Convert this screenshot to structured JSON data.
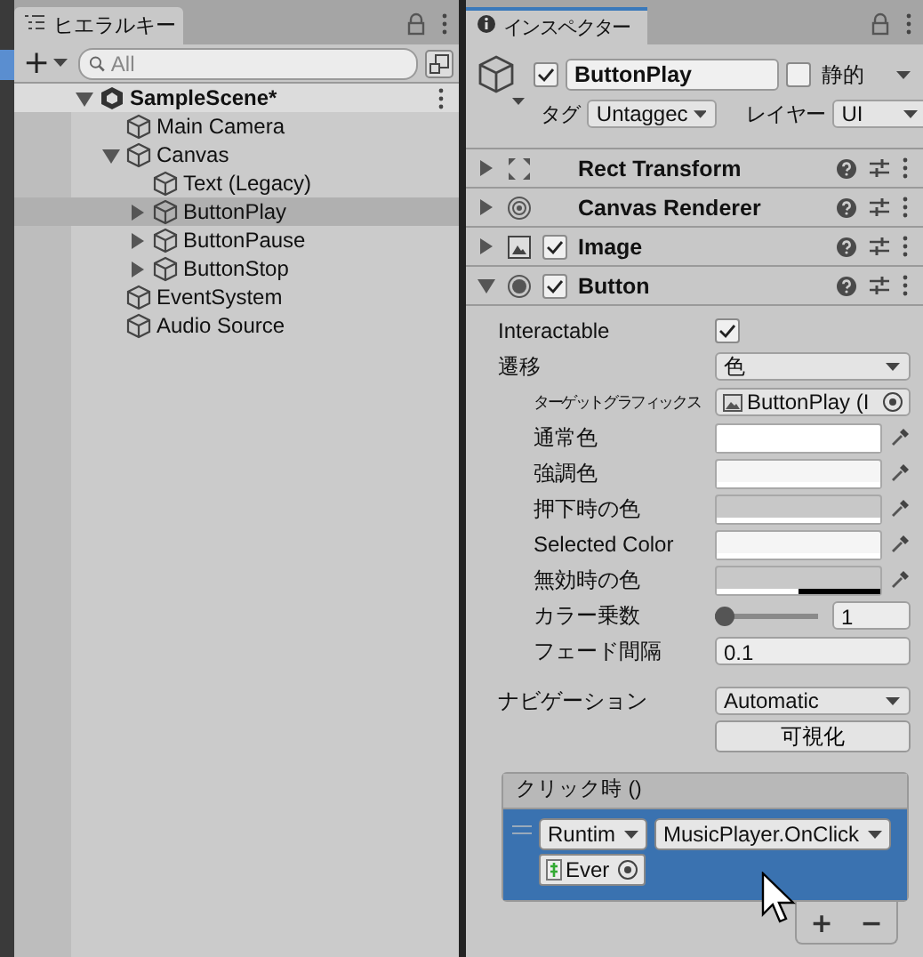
{
  "hierarchy": {
    "tab": "ヒエラルキー",
    "add_button": "+",
    "search": {
      "placeholder": "All"
    },
    "scene": {
      "name": "SampleScene*",
      "expanded": true
    },
    "items": [
      {
        "name": "Main Camera",
        "selected": false
      },
      {
        "name": "Canvas",
        "selected": false,
        "expanded": true,
        "children": [
          {
            "name": "Text (Legacy)",
            "selected": false
          },
          {
            "name": "ButtonPlay",
            "selected": true,
            "expanded": false
          },
          {
            "name": "ButtonPause",
            "selected": false,
            "expanded": false
          },
          {
            "name": "ButtonStop",
            "selected": false,
            "expanded": false
          }
        ]
      },
      {
        "name": "EventSystem",
        "selected": false
      },
      {
        "name": "Audio Source",
        "selected": false
      }
    ]
  },
  "inspector": {
    "tab": "インスペクター",
    "object": {
      "active": true,
      "name": "ButtonPlay",
      "static": false,
      "static_label": "静的",
      "tag_label": "タグ",
      "tag": "Untaggec",
      "layer_label": "レイヤー",
      "layer": "UI"
    },
    "components": [
      {
        "kind": "rect",
        "name": "Rect Transform",
        "expanded": false
      },
      {
        "kind": "renderer",
        "name": "Canvas Renderer",
        "expanded": false
      },
      {
        "kind": "image",
        "name": "Image",
        "expanded": false,
        "enabled": true
      },
      {
        "kind": "button",
        "name": "Button",
        "expanded": true,
        "enabled": true
      }
    ],
    "fields": [
      {
        "kind": "checkbox",
        "label": "Interactable",
        "checked": true
      },
      {
        "kind": "dropdown",
        "label": "遷移",
        "value": "色",
        "children": [
          {
            "kind": "object",
            "label": "ターゲットグラフィックス",
            "value": "ButtonPlay (I"
          },
          {
            "kind": "color",
            "label": "通常色",
            "color": "#ffffff",
            "level": 1
          },
          {
            "kind": "color",
            "label": "強調色",
            "color": "#f5f5f5",
            "level": 1
          },
          {
            "kind": "color",
            "label": "押下時の色",
            "color": "#c8c8c8",
            "level": 1
          },
          {
            "kind": "color",
            "label": "Selected Color",
            "color": "#f5f5f5",
            "level": 1
          },
          {
            "kind": "color",
            "label": "無効時の色",
            "color": "#c8c8c8",
            "level": 0.5
          },
          {
            "kind": "slider",
            "label": "カラー乗数",
            "level": 0,
            "value": "1"
          },
          {
            "kind": "number",
            "label": "フェード間隔",
            "value": "0.1"
          }
        ]
      },
      {
        "kind": "dropdown",
        "label": "ナビゲーション",
        "value": "Automatic"
      },
      {
        "kind": "button",
        "value": "可視化"
      }
    ],
    "event": {
      "title": "クリック時 ()",
      "entries": [
        {
          "selected": true,
          "runtime": "Runtim",
          "function": "MusicPlayer.OnClick",
          "object": "Ever"
        }
      ],
      "add_button": "+",
      "remove_button": "−"
    }
  }
}
